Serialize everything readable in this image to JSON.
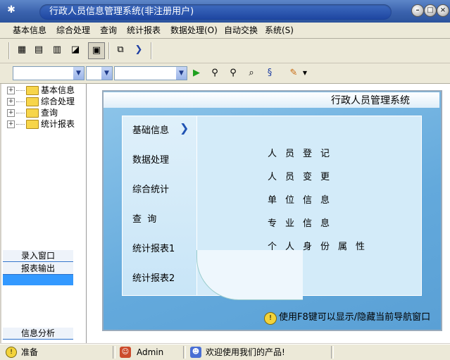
{
  "window": {
    "title": "行政人员信息管理系统(非注册用户)",
    "app_icon": "gear-icon",
    "controls": [
      "minimize",
      "restore",
      "close"
    ]
  },
  "menu": [
    "基本信息",
    "综合处理",
    "查询",
    "统计报表",
    "数据处理(O)",
    "自动交换",
    "系统(S)"
  ],
  "toolbar": {
    "icons": [
      "tree-view-icon",
      "card-icon",
      "document-icon",
      "chart-icon",
      "monitor-icon",
      "import-icon",
      "next-icon"
    ],
    "search_icons": [
      "run-icon",
      "find-person-icon",
      "find-person-plus-icon",
      "search-doc-icon",
      "filter-icon",
      "pencil-icon"
    ]
  },
  "tree": {
    "items": [
      "基本信息",
      "综合处理",
      "查询",
      "统计报表"
    ]
  },
  "side_tabs": {
    "entry": "录入窗口",
    "report": "报表输出",
    "analysis": "信息分析"
  },
  "main": {
    "title": "行政人员管理系统",
    "nav": [
      "基础信息",
      "数据处理",
      "综合统计",
      "查  询",
      "统计报表1",
      "统计报表2"
    ],
    "content": [
      "人员登记",
      "人员变更",
      "单位信息",
      "专业信息",
      "个人身份属性"
    ],
    "hint": "使用F8键可以显示/隐藏当前导航窗口"
  },
  "status": {
    "ready": "准备",
    "user": "Admin",
    "welcome": "欢迎使用我们的产品!"
  },
  "colors": {
    "title_bar": "#3a62ad",
    "panel_blue": "#63a9dc",
    "selected_tab": "#3399ff"
  }
}
